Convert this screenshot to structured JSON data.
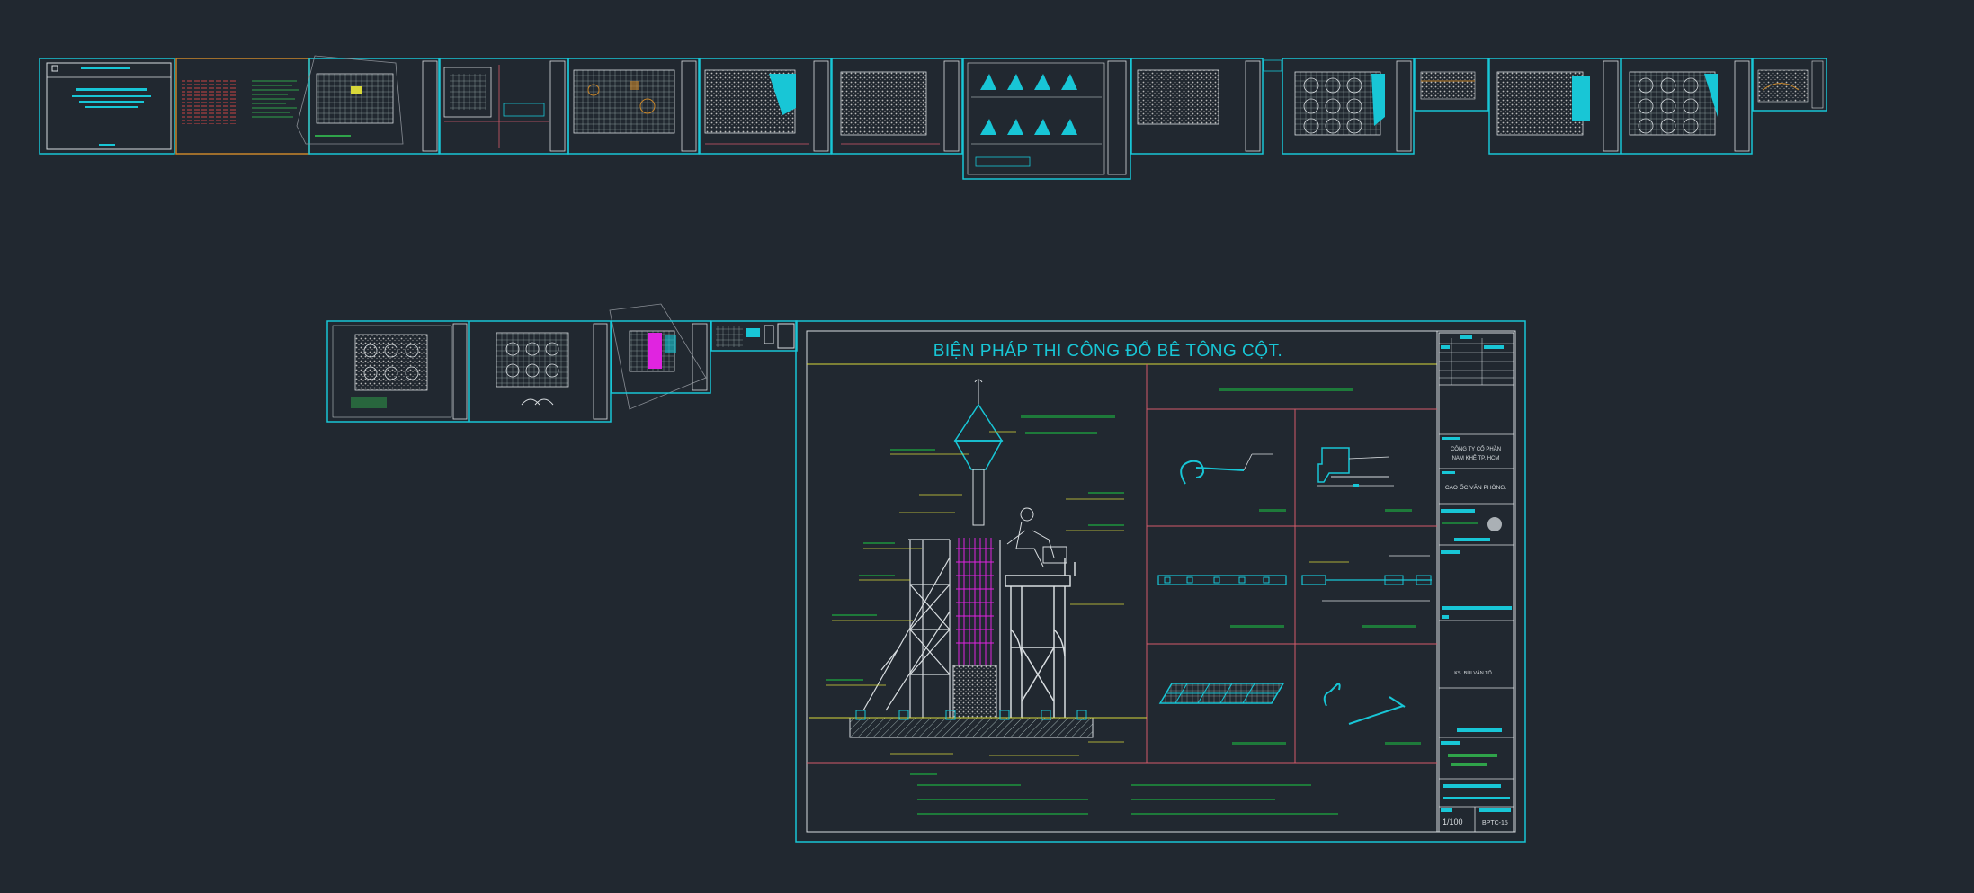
{
  "main_sheet": {
    "title": "BIỆN PHÁP THI CÔNG ĐỔ BÊ TÔNG CỘT.",
    "company_line1": "CÔNG TY CỔ PHẦN",
    "company_line2": "NAM KHÊ TP. HCM",
    "project": "CAO ỐC VĂN PHÒNG.",
    "signer": "KS. BÙI VĂN TỐ",
    "scale": "1/100",
    "sheet_code": "BPTC-15"
  },
  "colors": {
    "background": "#212830",
    "cyan": "#18c6d6",
    "yellow": "#d8d83a",
    "red": "#d25a6a",
    "magenta": "#e024e0",
    "green": "#1e7a3a",
    "white": "#d8dde0",
    "orange": "#c8862a"
  },
  "thumbnails_row1": 14,
  "thumbnails_row2": 4
}
